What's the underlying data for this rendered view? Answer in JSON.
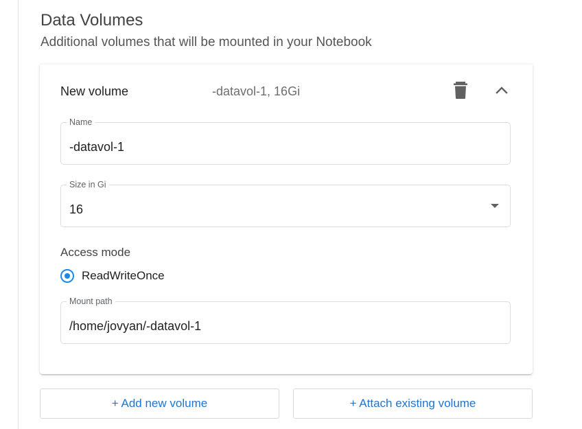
{
  "section": {
    "title": "Data Volumes",
    "subtitle": "Additional volumes that will be mounted in your Notebook"
  },
  "volume": {
    "header_title": "New volume",
    "header_desc": "-datavol-1, 16Gi",
    "delete_icon": "trash-icon",
    "collapse_icon": "chevron-up-icon",
    "name_field": {
      "label": "Name",
      "value": "-datavol-1"
    },
    "size_field": {
      "label": "Size in Gi",
      "value": "16"
    },
    "access_mode": {
      "label": "Access mode",
      "options": [
        {
          "label": "ReadWriteOnce",
          "selected": true
        }
      ]
    },
    "mount_field": {
      "label": "Mount path",
      "value": "/home/jovyan/-datavol-1"
    }
  },
  "actions": {
    "add_label": "+ Add new volume",
    "attach_label": "+ Attach existing volume"
  },
  "colors": {
    "accent": "#1e88e5",
    "link_text": "#1e74d1",
    "border": "#dadce0"
  }
}
